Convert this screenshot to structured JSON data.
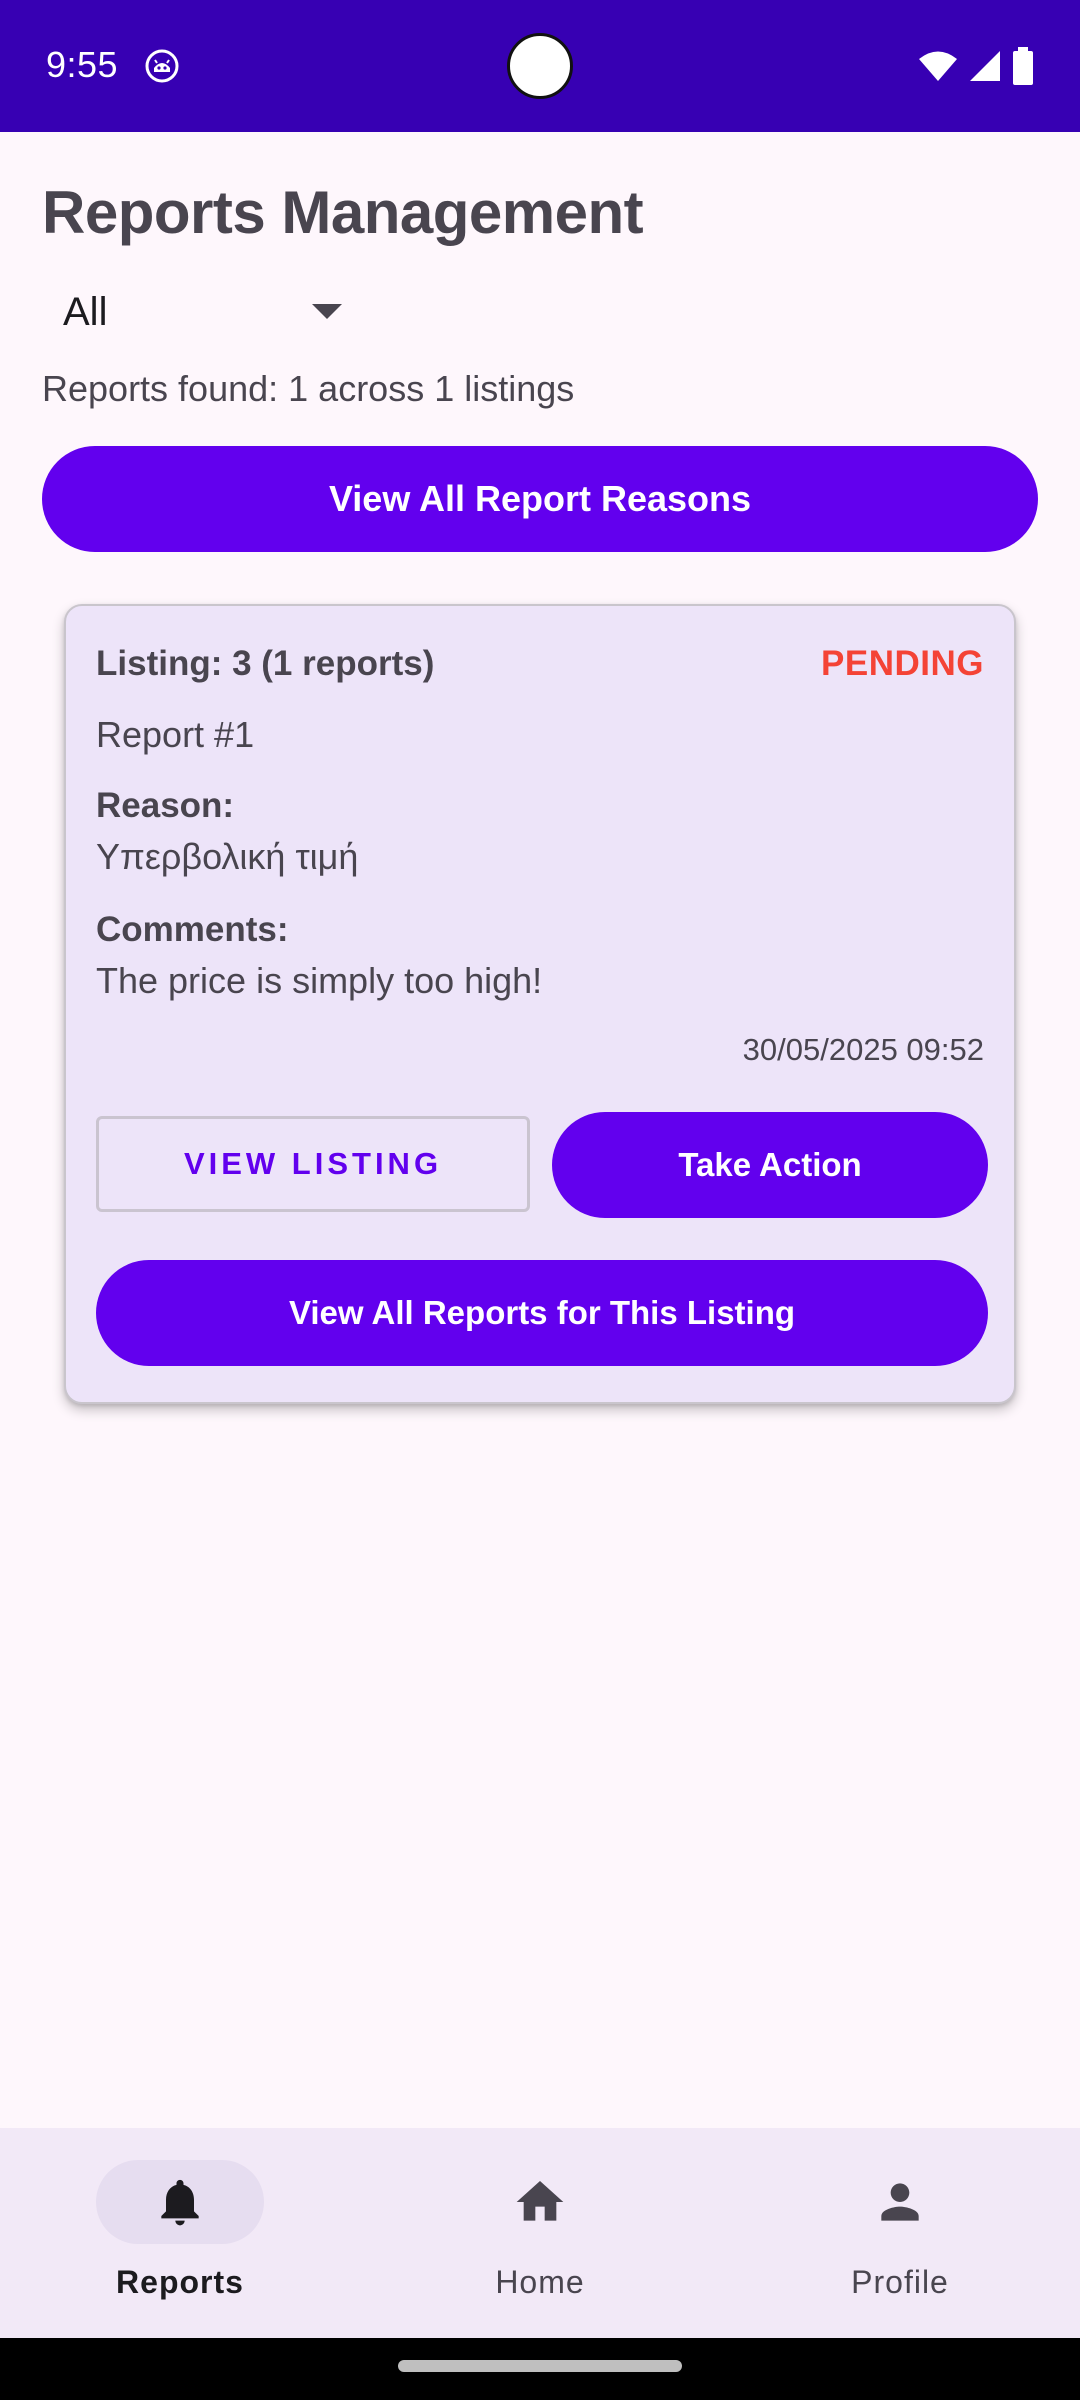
{
  "status_bar": {
    "time": "9:55"
  },
  "header": {
    "title": "Reports Management"
  },
  "filter": {
    "selected": "All"
  },
  "summary": "Reports found: 1 across 1 listings",
  "view_reasons_button": "View All Report Reasons",
  "report_card": {
    "listing": "Listing: 3 (1 reports)",
    "status": "PENDING",
    "report_number": "Report #1",
    "reason_label": "Reason:",
    "reason_value": "Υπερβολική τιμή",
    "comments_label": "Comments:",
    "comments_value": "The price is simply too high!",
    "date": "30/05/2025 09:52",
    "view_listing_button": "VIEW LISTING",
    "take_action_button": "Take Action",
    "view_all_reports_button": "View All Reports for This Listing"
  },
  "bottom_nav": {
    "items": [
      {
        "label": "Reports",
        "icon": "bell-icon",
        "active": true
      },
      {
        "label": "Home",
        "icon": "home-icon",
        "active": false
      },
      {
        "label": "Profile",
        "icon": "person-icon",
        "active": false
      }
    ]
  },
  "colors": {
    "status_bar": "#3700b3",
    "primary": "#6200ee",
    "pending": "#f44336",
    "card_bg": "#ede4f9",
    "background": "#fef7fc",
    "nav_bg": "#f2e9f7"
  }
}
